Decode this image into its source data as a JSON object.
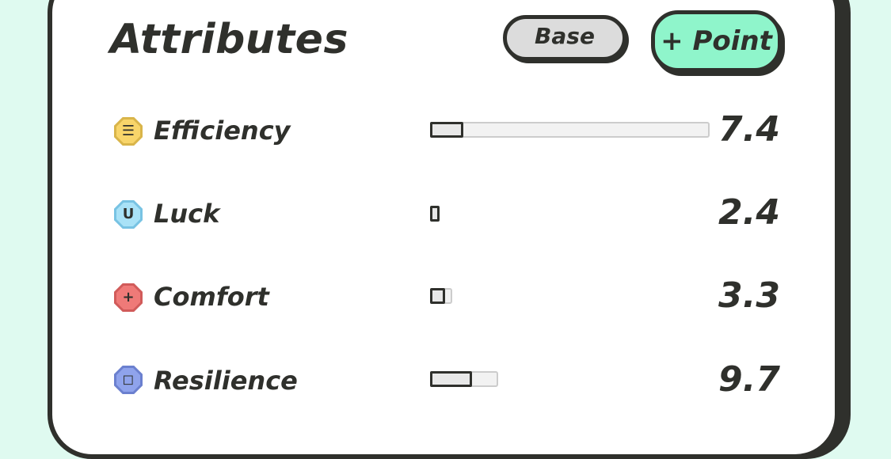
{
  "header": {
    "title": "Attributes",
    "base_label": "Base",
    "point_label": "+ Point"
  },
  "attributes": [
    {
      "name": "Efficiency",
      "value": "7.4",
      "icon": "lines-icon",
      "glyph": "☰",
      "color": "#f8d56a",
      "border": "#d9b54a",
      "bar_fill_fraction": 0.12
    },
    {
      "name": "Luck",
      "value": "2.4",
      "icon": "magnet-icon",
      "glyph": "U",
      "color": "#a9e2f7",
      "border": "#78c3e3",
      "bar_fill_fraction": 0.035
    },
    {
      "name": "Comfort",
      "value": "3.3",
      "icon": "plus-icon",
      "glyph": "+",
      "color": "#ef7a78",
      "border": "#d15b5a",
      "bar_fill_fraction": 0.055
    },
    {
      "name": "Resilience",
      "value": "9.7",
      "icon": "square-icon",
      "glyph": "◻",
      "color": "#8fa3ec",
      "border": "#6b80cf",
      "bar_fill_fraction": 0.15
    }
  ],
  "colors": {
    "background": "#dffaf0",
    "accent": "#8ff5cb",
    "text": "#2f302c"
  }
}
